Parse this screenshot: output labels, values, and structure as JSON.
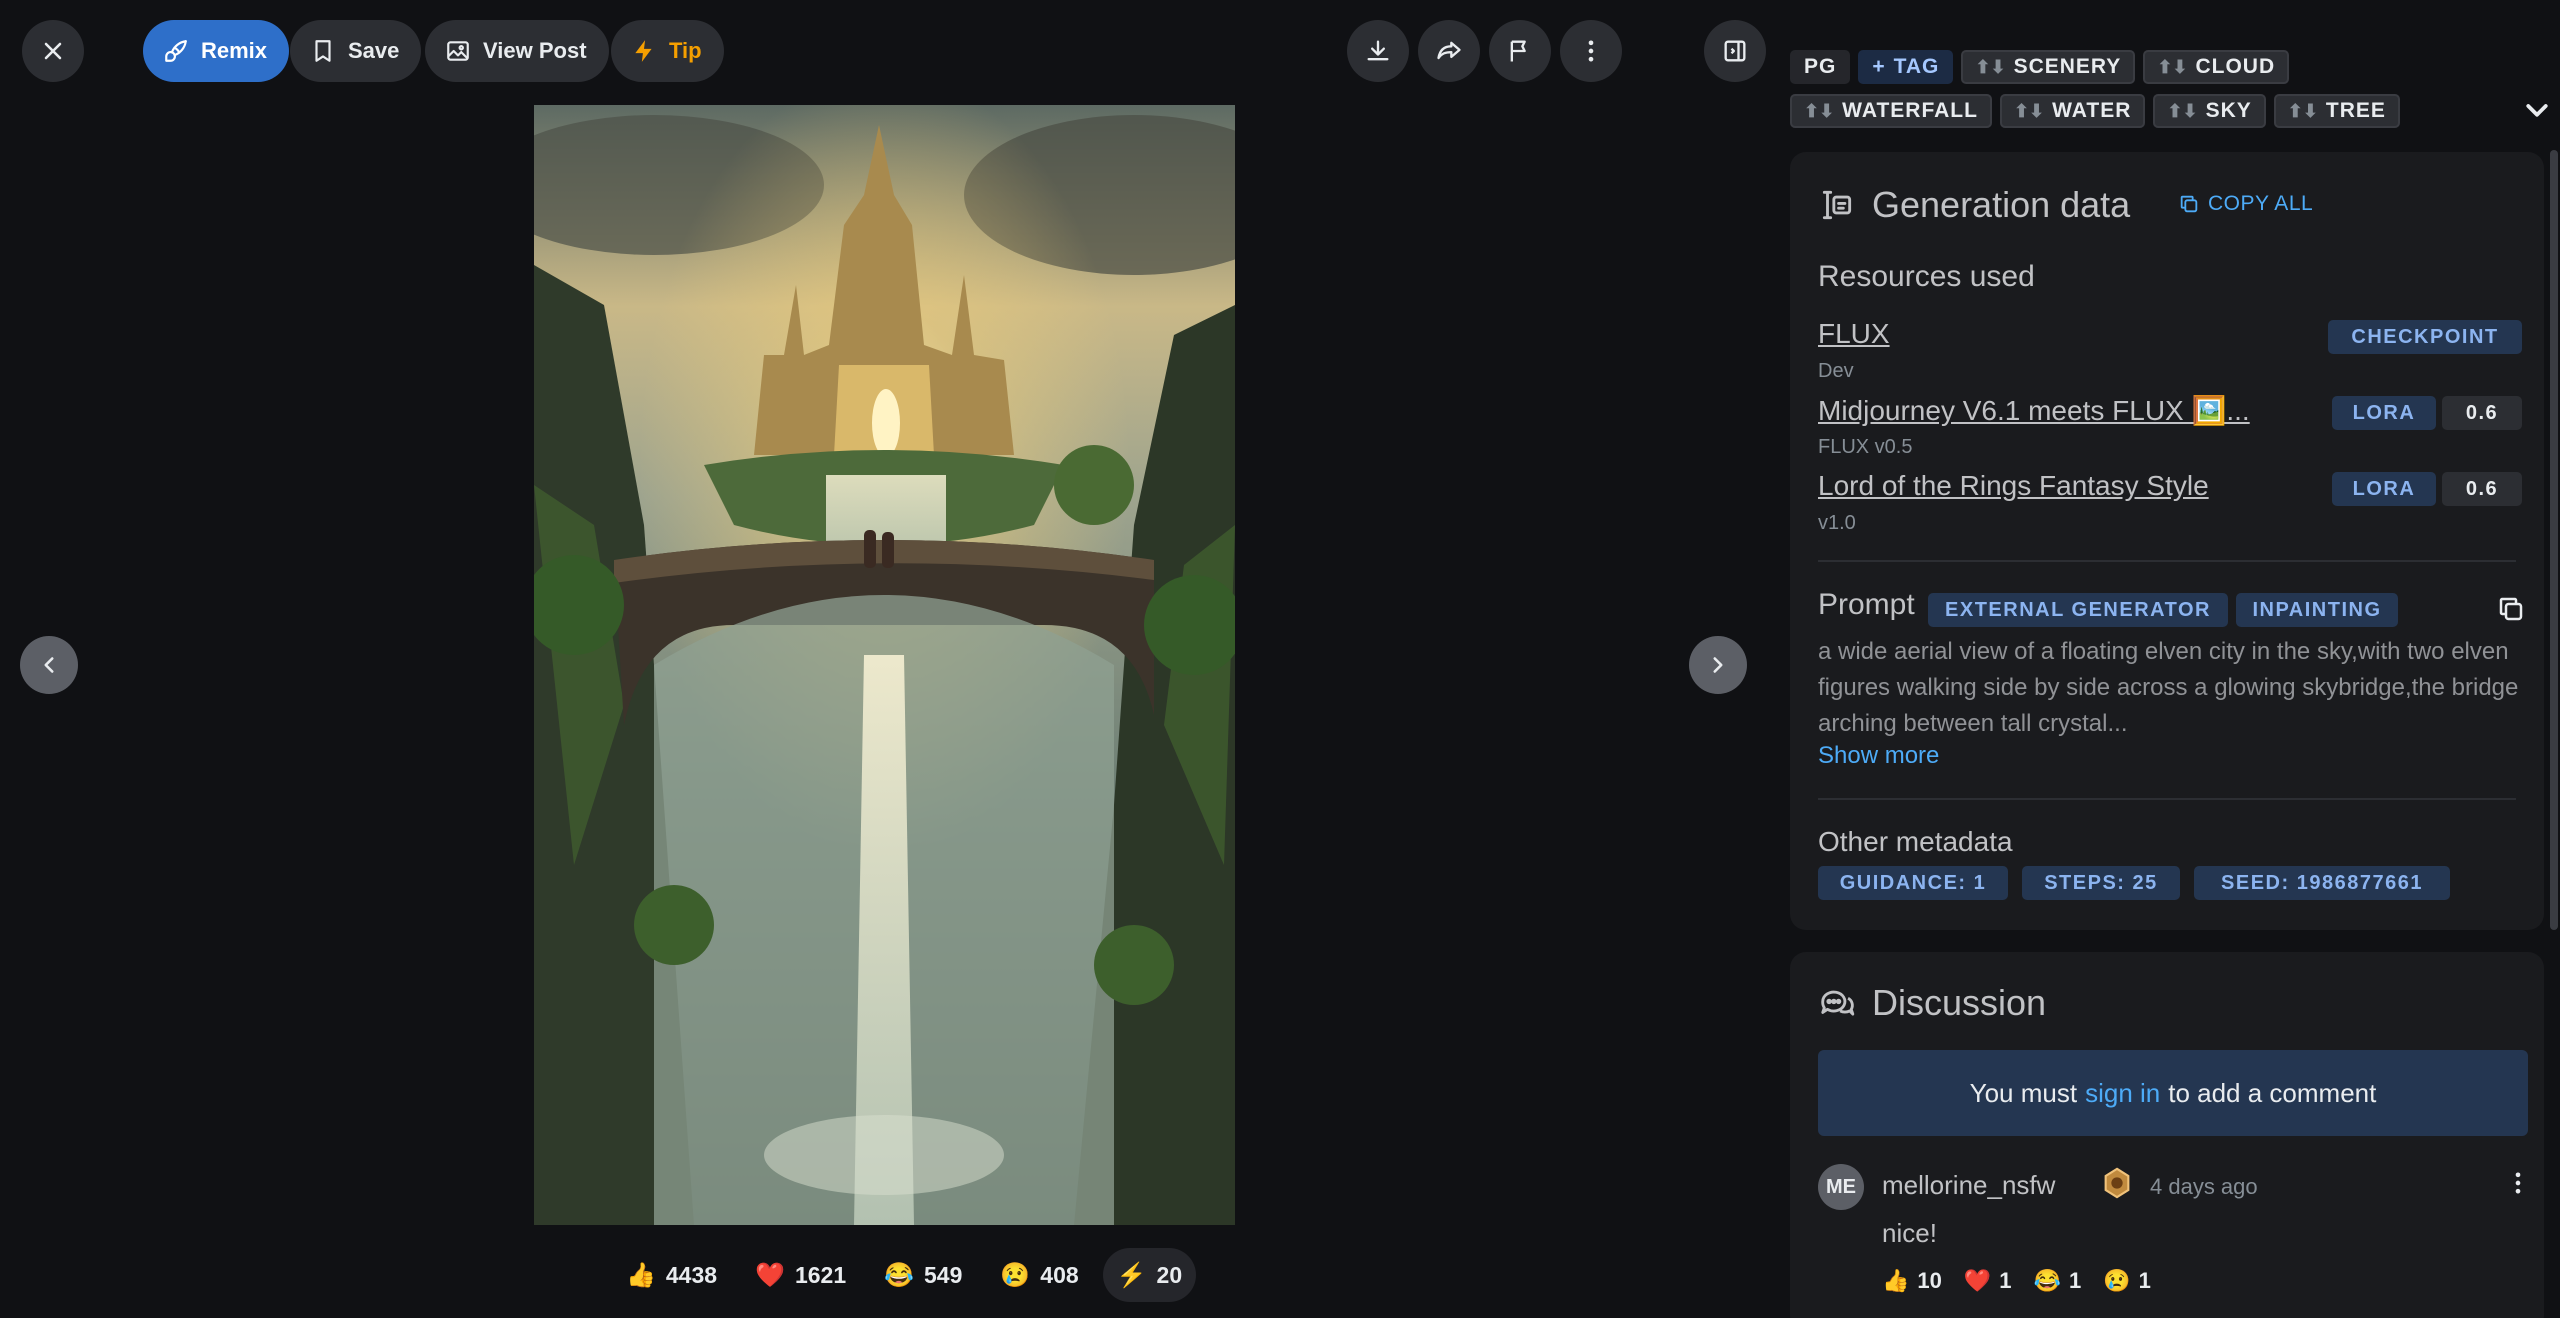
{
  "toolbar": {
    "remix_label": "Remix",
    "save_label": "Save",
    "view_post_label": "View Post",
    "tip_label": "Tip"
  },
  "reactions": [
    {
      "emoji": "👍",
      "count": "4438"
    },
    {
      "emoji": "❤️",
      "count": "1621"
    },
    {
      "emoji": "😂",
      "count": "549"
    },
    {
      "emoji": "😢",
      "count": "408"
    },
    {
      "emoji": "⚡",
      "count": "20"
    }
  ],
  "tags": {
    "rating": "PG",
    "add_tag": "TAG",
    "row1": [
      "SCENERY",
      "CLOUD"
    ],
    "row2": [
      "WATERFALL",
      "WATER",
      "SKY",
      "TREE"
    ]
  },
  "generation": {
    "title": "Generation data",
    "copy_all": "COPY ALL",
    "resources_heading": "Resources used",
    "resources": [
      {
        "name": "FLUX",
        "version": "Dev",
        "type": "CHECKPOINT",
        "weight": ""
      },
      {
        "name": "Midjourney V6.1 meets FLUX 🖼️...",
        "version": "FLUX v0.5",
        "type": "LORA",
        "weight": "0.6"
      },
      {
        "name": "Lord of the Rings Fantasy Style",
        "version": "v1.0",
        "type": "LORA",
        "weight": "0.6"
      }
    ],
    "prompt_heading": "Prompt",
    "prompt_badges": [
      "EXTERNAL GENERATOR",
      "INPAINTING"
    ],
    "prompt_text": "a wide aerial view of a floating elven city in the sky,with two elven figures walking side by side across a glowing skybridge,the bridge arching between tall crystal...",
    "show_more": "Show more",
    "other_heading": "Other metadata",
    "metadata": [
      "GUIDANCE: 1",
      "STEPS: 25",
      "SEED: 1986877661"
    ]
  },
  "discussion": {
    "title": "Discussion",
    "signin_prefix": "You must",
    "signin_link": "sign in",
    "signin_suffix": "to add a comment",
    "comment": {
      "initials": "ME",
      "user": "mellorine_nsfw",
      "time": "4 days ago",
      "body": "nice!",
      "reactions": [
        {
          "emoji": "👍",
          "count": "10"
        },
        {
          "emoji": "❤️",
          "count": "1"
        },
        {
          "emoji": "😂",
          "count": "1"
        },
        {
          "emoji": "😢",
          "count": "1"
        }
      ]
    }
  },
  "colors": {
    "accent": "#2e6fc9",
    "tip": "#f59f00",
    "link": "#4dabf7",
    "badge_bg": "#243651"
  }
}
